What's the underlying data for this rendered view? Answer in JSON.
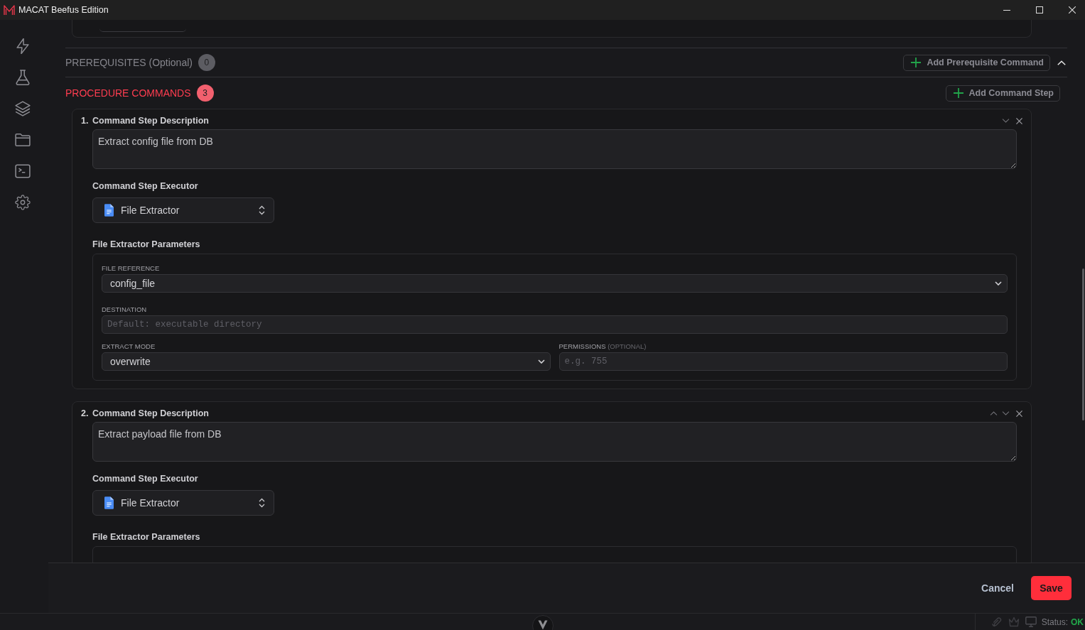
{
  "window": {
    "title": "MACAT Beefus Edition"
  },
  "prerequisites": {
    "title": "PREREQUISITES (Optional)",
    "count": "0",
    "active": false,
    "add_button": "Add Prerequisite Command",
    "expanded": true
  },
  "procedure": {
    "title": "PROCEDURE COMMANDS",
    "count": "3",
    "active": true,
    "add_button": "Add Command Step",
    "steps": [
      {
        "number": "1.",
        "label": "Command Step Description",
        "description": "Extract config file from DB",
        "can_move_up": false,
        "can_move_down": true,
        "executor_label": "Command Step Executor",
        "executor": "File Extractor",
        "params_label": "File Extractor Parameters",
        "param_rows": [
          [
            {
              "kind": "select",
              "label": "FILE REFERENCE",
              "value": "config_file"
            }
          ],
          [
            {
              "kind": "input",
              "label": "DESTINATION",
              "placeholder": "Default: executable directory"
            }
          ],
          [
            {
              "kind": "select",
              "label": "EXTRACT MODE",
              "value": "overwrite"
            },
            {
              "kind": "input",
              "label": "PERMISSIONS",
              "note": "(OPTIONAL)",
              "placeholder": "e.g. 755"
            }
          ]
        ]
      },
      {
        "number": "2.",
        "label": "Command Step Description",
        "description": "Extract payload file from DB",
        "can_move_up": true,
        "can_move_down": true,
        "executor_label": "Command Step Executor",
        "executor": "File Extractor",
        "params_label": "File Extractor Parameters"
      }
    ]
  },
  "footer": {
    "cancel": "Cancel",
    "save": "Save"
  },
  "status_bar": {
    "label": "Status:",
    "value": "OK"
  }
}
